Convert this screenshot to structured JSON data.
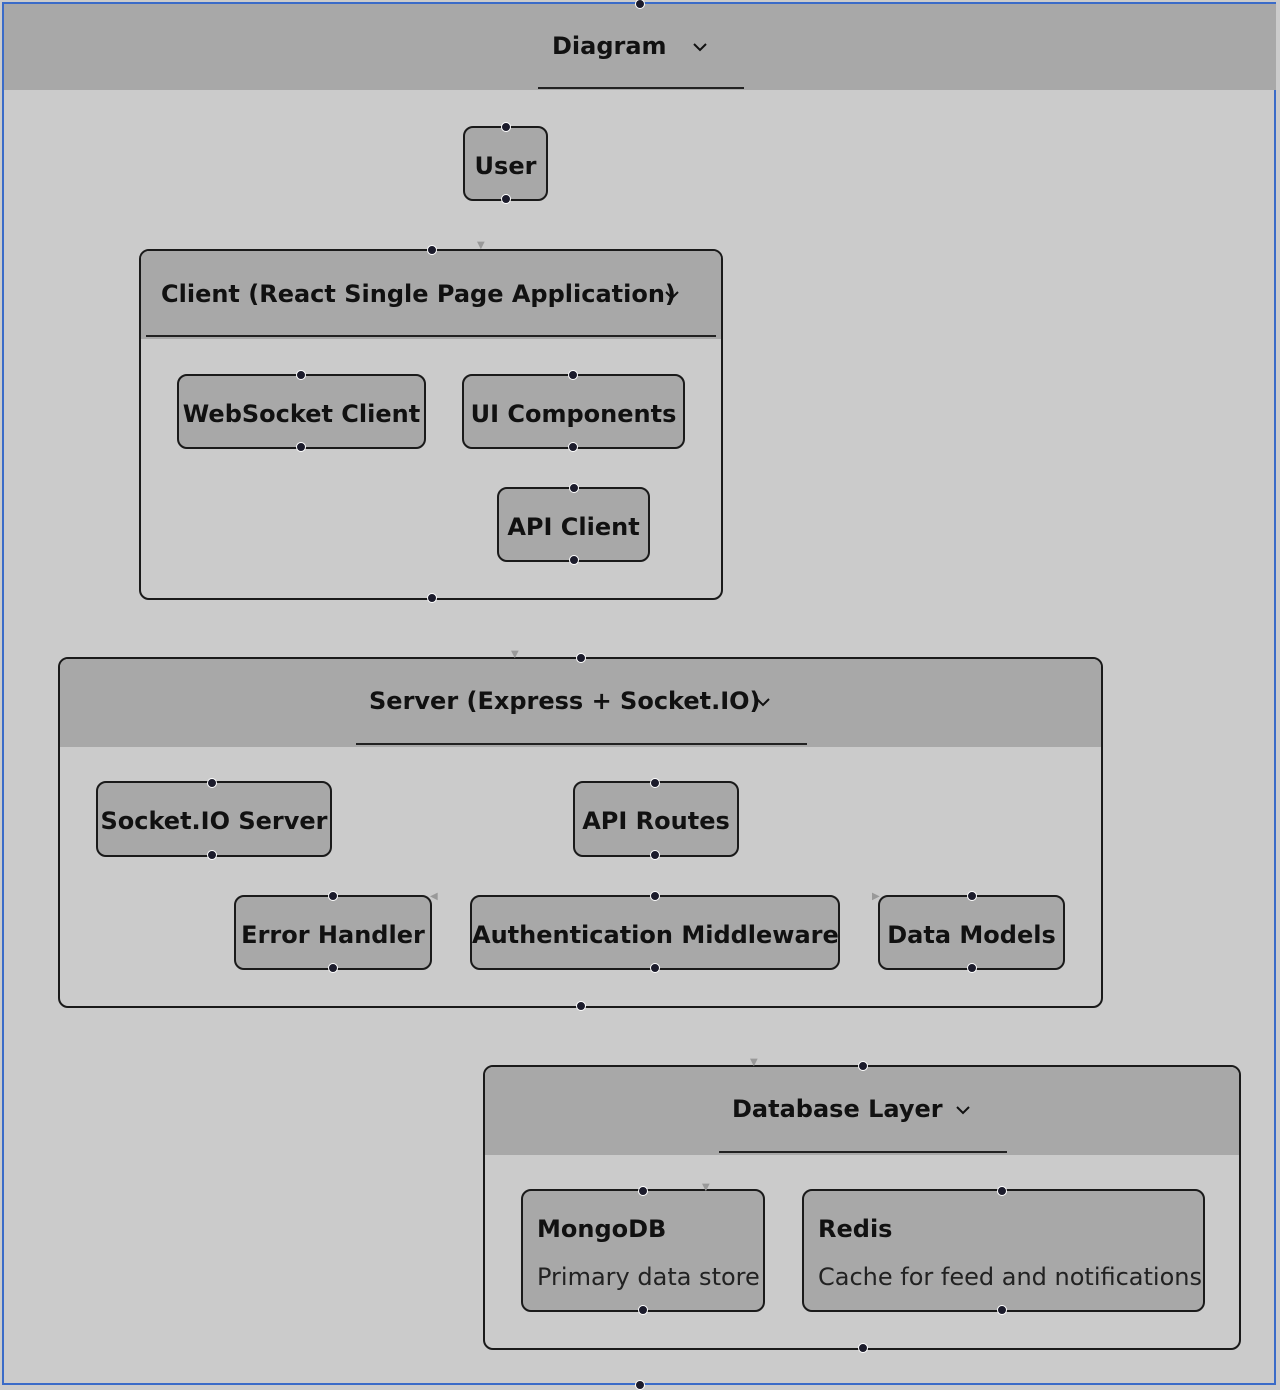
{
  "diagram": {
    "title": "Diagram"
  },
  "groups": {
    "client": {
      "title": "Client (React Single Page Application)",
      "nodes": {
        "websocket": "WebSocket Client",
        "ui": "UI Components",
        "api": "API Client"
      }
    },
    "server": {
      "title": "Server (Express + Socket.IO)",
      "nodes": {
        "socketio": "Socket.IO Server",
        "routes": "API Routes",
        "error": "Error Handler",
        "auth": "Authentication Middleware",
        "models": "Data Models"
      }
    },
    "database": {
      "title": "Database Layer",
      "nodes": {
        "mongodb": {
          "title": "MongoDB",
          "description": "Primary data store"
        },
        "redis": {
          "title": "Redis",
          "description": "Cache for feed and notifications"
        }
      }
    }
  },
  "user_node": "User",
  "icons": [
    "chevron-down-icon"
  ],
  "colors": {
    "canvas": "#cbcbcb",
    "header": "#a8a8a8",
    "selection_border": "#3a6bc8",
    "port": "#1b1b2b"
  }
}
